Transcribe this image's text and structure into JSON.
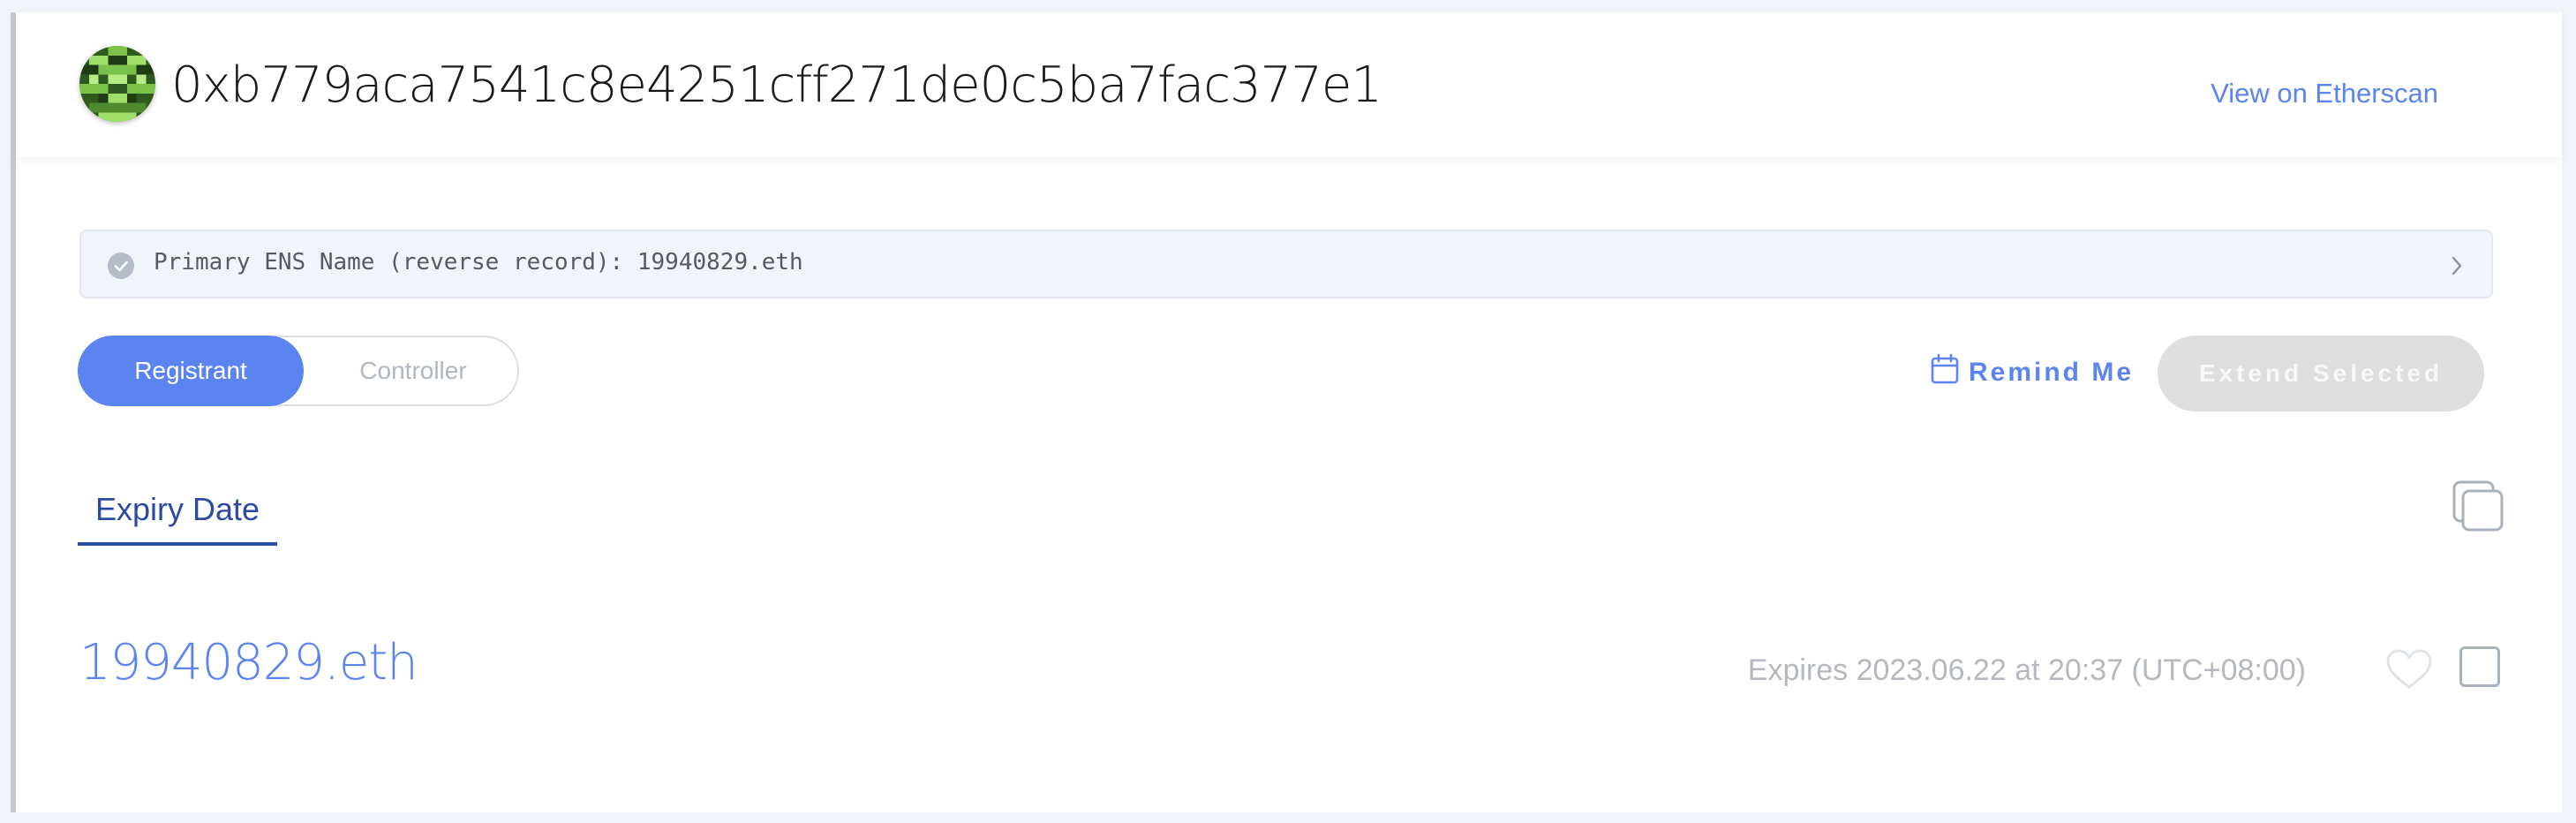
{
  "header": {
    "address": "0xb779aca7541c8e4251cff271de0c5ba7fac377e1",
    "etherscan_link": "View on Etherscan"
  },
  "ens_bar": {
    "text": "Primary ENS Name (reverse record): 19940829.eth"
  },
  "role_toggle": {
    "active": "Registrant",
    "inactive": "Controller"
  },
  "actions": {
    "remind_me": "Remind Me",
    "extend_selected": "Extend Selected"
  },
  "sort_tabs": {
    "expiry_date": "Expiry Date"
  },
  "domains": [
    {
      "name": "19940829.eth",
      "expiry": "Expires 2023.06.22 at 20:37 (UTC+08:00)"
    }
  ],
  "colors": {
    "accent": "#5b84f0",
    "tab_active": "#2b4aa3",
    "disabled_button": "#dedede",
    "muted_text": "#b5b9bf"
  },
  "icons": [
    "avatar-identicon",
    "check-circle-icon",
    "chevron-right-icon",
    "calendar-icon",
    "copy-icon",
    "heart-icon",
    "checkbox"
  ]
}
